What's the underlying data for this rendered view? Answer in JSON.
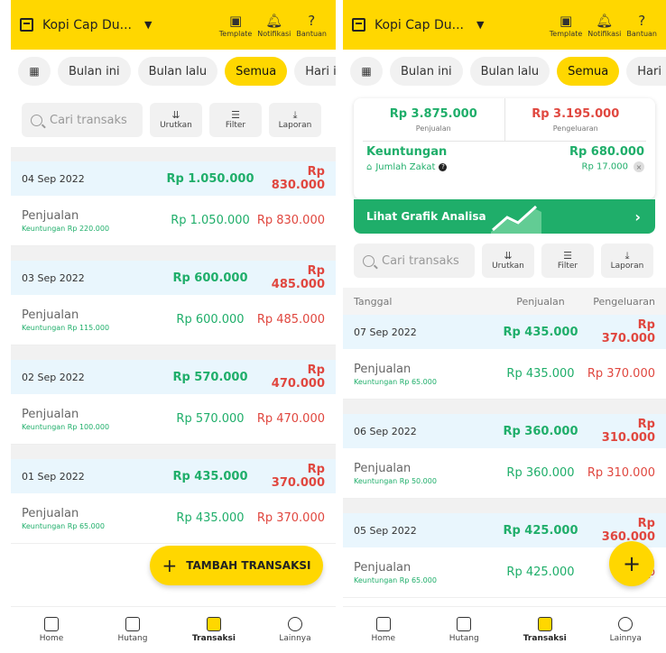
{
  "header": {
    "store_name": "Kopi Cap Du...",
    "icons": [
      {
        "name": "template",
        "label": "Template",
        "glyph": "▣"
      },
      {
        "name": "notifikasi",
        "label": "Notifikasi",
        "glyph": "🔔︎"
      },
      {
        "name": "bantuan",
        "label": "Bantuan",
        "glyph": "?"
      }
    ]
  },
  "filters": {
    "chips": [
      "Bulan ini",
      "Bulan lalu",
      "Semua",
      "Hari in"
    ],
    "active": "Semua"
  },
  "search": {
    "placeholder": "Cari transaks",
    "tools": [
      {
        "label": "Urutkan",
        "glyph": "⇊"
      },
      {
        "label": "Filter",
        "glyph": "☰"
      },
      {
        "label": "Laporan",
        "glyph": "⤓"
      }
    ]
  },
  "left_screen": {
    "days": [
      {
        "date": "04 Sep 2022",
        "in": "Rp 1.050.000",
        "out": "Rp 830.000",
        "label": "Penjualan",
        "profit": "Keuntungan Rp 220.000",
        "row_in": "Rp 1.050.000",
        "row_out": "Rp 830.000"
      },
      {
        "date": "03 Sep 2022",
        "in": "Rp 600.000",
        "out": "Rp 485.000",
        "label": "Penjualan",
        "profit": "Keuntungan Rp 115.000",
        "row_in": "Rp 600.000",
        "row_out": "Rp 485.000"
      },
      {
        "date": "02 Sep 2022",
        "in": "Rp 570.000",
        "out": "Rp 470.000",
        "label": "Penjualan",
        "profit": "Keuntungan Rp 100.000",
        "row_in": "Rp 570.000",
        "row_out": "Rp 470.000"
      },
      {
        "date": "01 Sep 2022",
        "in": "Rp 435.000",
        "out": "Rp 370.000",
        "label": "Penjualan",
        "profit": "Keuntungan Rp 65.000",
        "row_in": "Rp 435.000",
        "row_out": "Rp 370.000"
      }
    ],
    "fab_label": "TAMBAH TRANSAKSI"
  },
  "right_screen": {
    "summary": {
      "sales": "Rp 3.875.000",
      "sales_label": "Penjualan",
      "expense": "Rp 3.195.000",
      "expense_label": "Pengeluaran",
      "profit_label": "Keuntungan",
      "profit": "Rp 680.000",
      "zakat_label": "Jumlah Zakat",
      "zakat": "Rp 17.000",
      "chart_link": "Lihat Grafik Analisa"
    },
    "columns": {
      "date": "Tanggal",
      "sales": "Penjualan",
      "expense": "Pengeluaran"
    },
    "days": [
      {
        "date": "07 Sep 2022",
        "in": "Rp 435.000",
        "out": "Rp 370.000",
        "label": "Penjualan",
        "profit": "Keuntungan Rp 65.000",
        "row_in": "Rp 435.000",
        "row_out": "Rp 370.000"
      },
      {
        "date": "06 Sep 2022",
        "in": "Rp 360.000",
        "out": "Rp 310.000",
        "label": "Penjualan",
        "profit": "Keuntungan Rp 50.000",
        "row_in": "Rp 360.000",
        "row_out": "Rp 310.000"
      },
      {
        "date": "05 Sep 2022",
        "in": "Rp 425.000",
        "out": "Rp 360.000",
        "label": "Penjualan",
        "profit": "Keuntungan Rp 65.000",
        "row_in": "Rp 425.000",
        "row_out": "Rp"
      }
    ]
  },
  "bottom_nav": [
    {
      "label": "Home",
      "icon": "home-icon"
    },
    {
      "label": "Hutang",
      "icon": "debt-icon"
    },
    {
      "label": "Transaksi",
      "icon": "transaction-icon",
      "active": true
    },
    {
      "label": "Lainnya",
      "icon": "profile-icon"
    }
  ],
  "colors": {
    "brand_yellow": "#FFD700",
    "income_green": "#1FAE6A",
    "expense_red": "#E0473F",
    "day_header_blue": "#E9F6FD"
  }
}
